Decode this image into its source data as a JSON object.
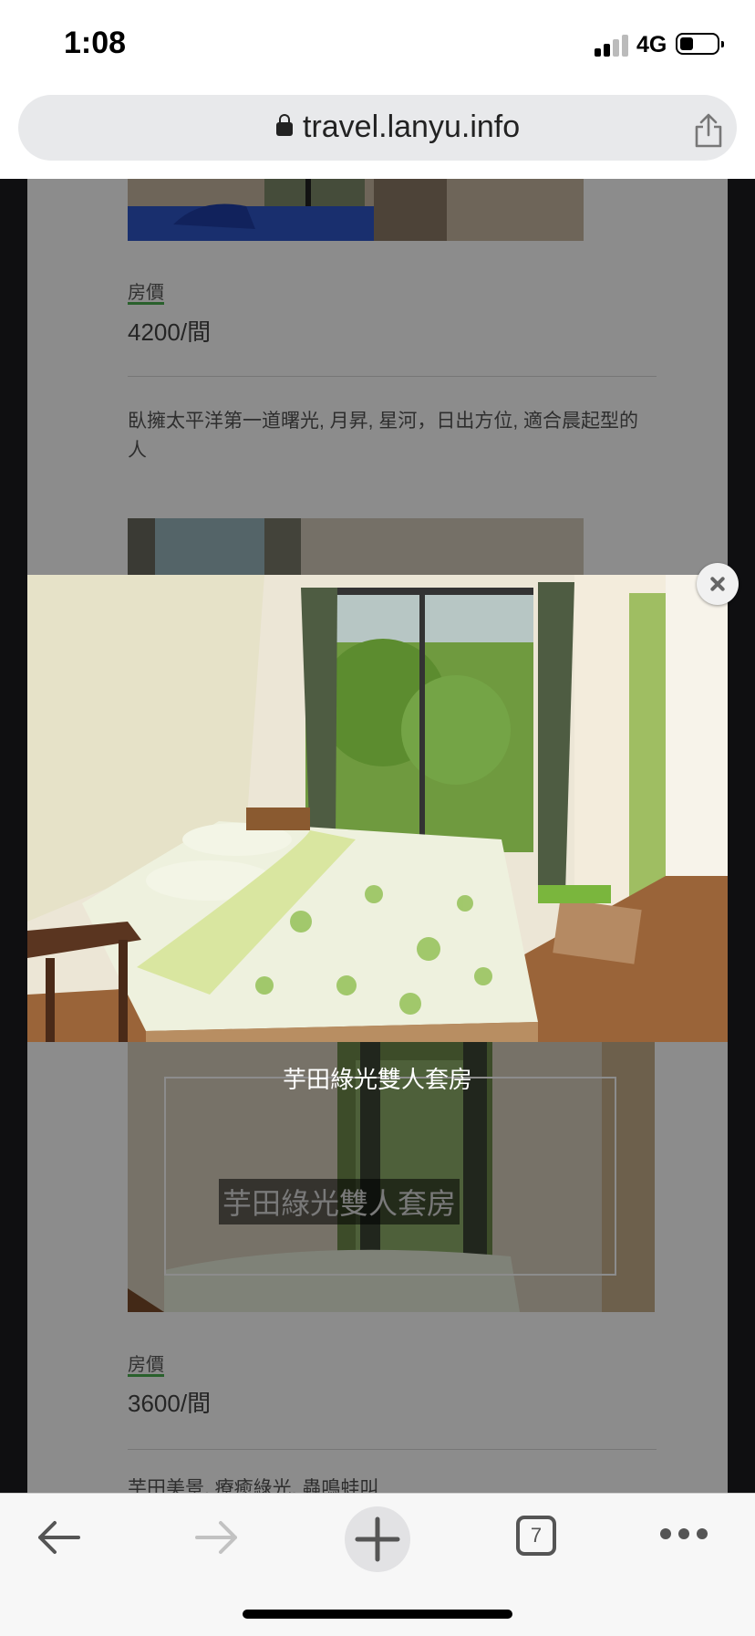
{
  "status_bar": {
    "time": "1:08",
    "network": "4G",
    "battery_level": 0.25
  },
  "browser": {
    "url": "travel.lanyu.info",
    "tab_count": "7"
  },
  "page": {
    "room1": {
      "price_label": "房價",
      "price": "4200/間",
      "description": "臥擁太平洋第一道曙光, 月昇, 星河，日出方位, 適合晨起型的人"
    },
    "room2": {
      "image_caption": "芋田綠光雙人套房",
      "price_label": "房價",
      "price": "3600/間",
      "description": "芋田美景, 療癒綠光, 蟲鳴蛙叫"
    }
  },
  "lightbox": {
    "caption": "芋田綠光雙人套房"
  },
  "icons": {
    "back": "back-arrow-icon",
    "forward": "forward-arrow-icon",
    "new_tab": "plus-icon",
    "tabs": "tabs-icon",
    "menu": "more-dots-icon",
    "share": "share-icon",
    "lock": "lock-icon",
    "close": "close-icon"
  }
}
